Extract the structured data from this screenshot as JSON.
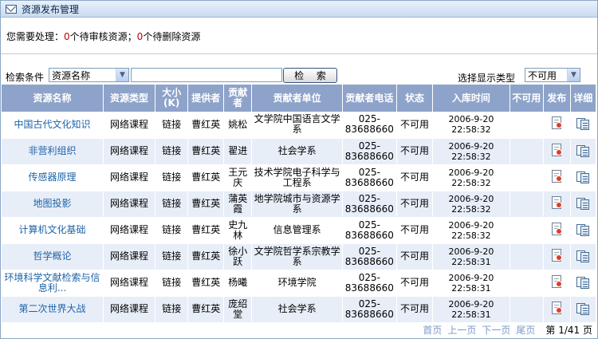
{
  "window": {
    "title": "资源发布管理",
    "icon": "mail-icon"
  },
  "pending": {
    "prefix": "您需要处理：",
    "review_count": "0",
    "review_text": "个待审核资源；",
    "delete_count": "0",
    "delete_text": "个待删除资源"
  },
  "search": {
    "label": "检索条件",
    "field_value": "资源名称",
    "input_value": "",
    "button_label": "检 索",
    "type_label": "选择显示类型",
    "type_value": "不可用"
  },
  "table": {
    "headers": [
      "资源名称",
      "资源类型",
      "大小(K)",
      "提供者",
      "贡献者",
      "贡献者单位",
      "贡献者电话",
      "状态",
      "入库时间",
      "不可用",
      "发布",
      "详细"
    ],
    "rows": [
      {
        "name": "中国古代文化知识",
        "type": "网络课程",
        "size": "链接",
        "provider": "曹红英",
        "contributor": "姚松",
        "unit": "文学院中国语言文学系",
        "phone": "025-83688660",
        "status": "不可用",
        "date": "2006-9-20",
        "time": "22:58:32",
        "disabled": ""
      },
      {
        "name": "非营利组织",
        "type": "网络课程",
        "size": "链接",
        "provider": "曹红英",
        "contributor": "翟进",
        "unit": "社会学系",
        "phone": "025-83688660",
        "status": "不可用",
        "date": "2006-9-20",
        "time": "22:58:32",
        "disabled": ""
      },
      {
        "name": "传感器原理",
        "type": "网络课程",
        "size": "链接",
        "provider": "曹红英",
        "contributor": "王元庆",
        "unit": "技术学院电子科学与工程系",
        "phone": "025-83688660",
        "status": "不可用",
        "date": "2006-9-20",
        "time": "22:58:32",
        "disabled": ""
      },
      {
        "name": "地图投影",
        "type": "网络课程",
        "size": "链接",
        "provider": "曹红英",
        "contributor": "蒲英霞",
        "unit": "地学院城市与资源学系",
        "phone": "025-83688660",
        "status": "不可用",
        "date": "2006-9-20",
        "time": "22:58:32",
        "disabled": ""
      },
      {
        "name": "计算机文化基础",
        "type": "网络课程",
        "size": "链接",
        "provider": "曹红英",
        "contributor": "史九林",
        "unit": "信息管理系",
        "phone": "025-83688660",
        "status": "不可用",
        "date": "2006-9-20",
        "time": "22:58:32",
        "disabled": ""
      },
      {
        "name": "哲学概论",
        "type": "网络课程",
        "size": "链接",
        "provider": "曹红英",
        "contributor": "徐小跃",
        "unit": "文学院哲学系宗教学系",
        "phone": "025-83688660",
        "status": "不可用",
        "date": "2006-9-20",
        "time": "22:58:31",
        "disabled": ""
      },
      {
        "name": "环境科学文献检索与信息利...",
        "type": "网络课程",
        "size": "链接",
        "provider": "曹红英",
        "contributor": "杨曦",
        "unit": "环境学院",
        "phone": "025-83688660",
        "status": "不可用",
        "date": "2006-9-20",
        "time": "22:58:31",
        "disabled": ""
      },
      {
        "name": "第二次世界大战",
        "type": "网络课程",
        "size": "链接",
        "provider": "曹红英",
        "contributor": "庞绍堂",
        "unit": "社会学系",
        "phone": "025-83688660",
        "status": "不可用",
        "date": "2006-9-20",
        "time": "22:58:31",
        "disabled": ""
      }
    ]
  },
  "pager": {
    "first": "首页",
    "prev": "上一页",
    "next": "下一页",
    "last": "尾页",
    "info": "第 1/41 页"
  }
}
